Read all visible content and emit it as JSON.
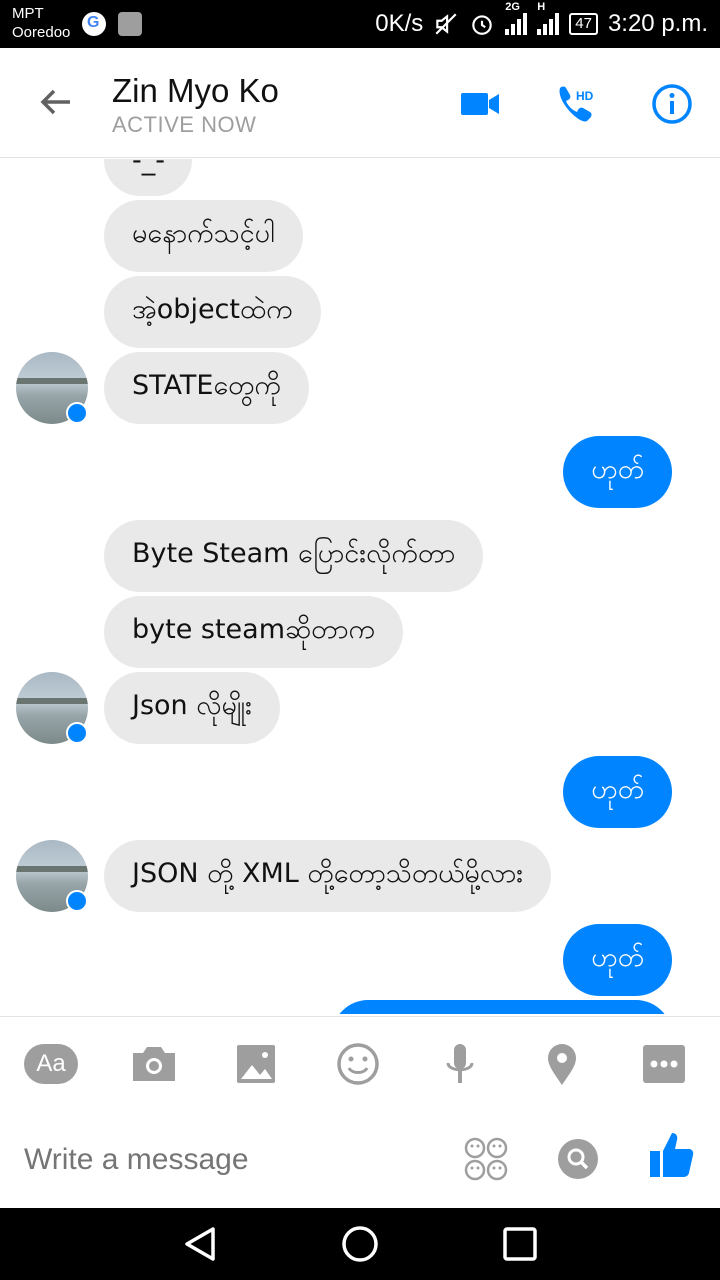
{
  "status": {
    "carrier_line1": "MPT",
    "carrier_line2": "Ooredoo",
    "net_speed": "0K/s",
    "network_2g": "2G",
    "network_h": "H",
    "battery": "47",
    "time": "3:20 p.m."
  },
  "header": {
    "contact_name": "Zin Myo Ko",
    "status_text": "ACTIVE NOW",
    "hd_label": "HD",
    "icons": [
      "back-arrow-icon",
      "video-call-icon",
      "voice-call-icon",
      "info-icon"
    ],
    "accent": "#0084ff"
  },
  "messages": [
    {
      "from": "them",
      "text": "-_-"
    },
    {
      "from": "them",
      "text": "မနောက်သင့်ပါ"
    },
    {
      "from": "them",
      "text": "အဲ့objectထဲက"
    },
    {
      "from": "them",
      "text": "STATEတွေကို"
    },
    {
      "from": "me",
      "text": "ဟုတ်"
    },
    {
      "from": "them",
      "text": "Byte Steam ပြောင်းလိုက်တာ"
    },
    {
      "from": "them",
      "text": "byte steamဆိုတာက"
    },
    {
      "from": "them",
      "text": "Json လိုမျိုး"
    },
    {
      "from": "me",
      "text": "ဟုတ်"
    },
    {
      "from": "them",
      "text": "JSON တို့ XML တို့တော့သိတယ်မို့လား"
    },
    {
      "from": "me",
      "text": "ဟုတ်"
    }
  ],
  "colors": {
    "incoming_bubble": "#e9e9e9",
    "outgoing_bubble": "#0084ff",
    "icon_grey": "#9e9e9e"
  },
  "composer": {
    "font_button_label": "Aa",
    "placeholder": "Write a message",
    "tools": [
      "font-icon",
      "camera-icon",
      "gallery-icon",
      "emoji-icon",
      "microphone-icon",
      "location-icon",
      "more-icon"
    ]
  },
  "navbar": {
    "buttons": [
      "back-triangle-icon",
      "home-circle-icon",
      "recents-square-icon"
    ]
  }
}
